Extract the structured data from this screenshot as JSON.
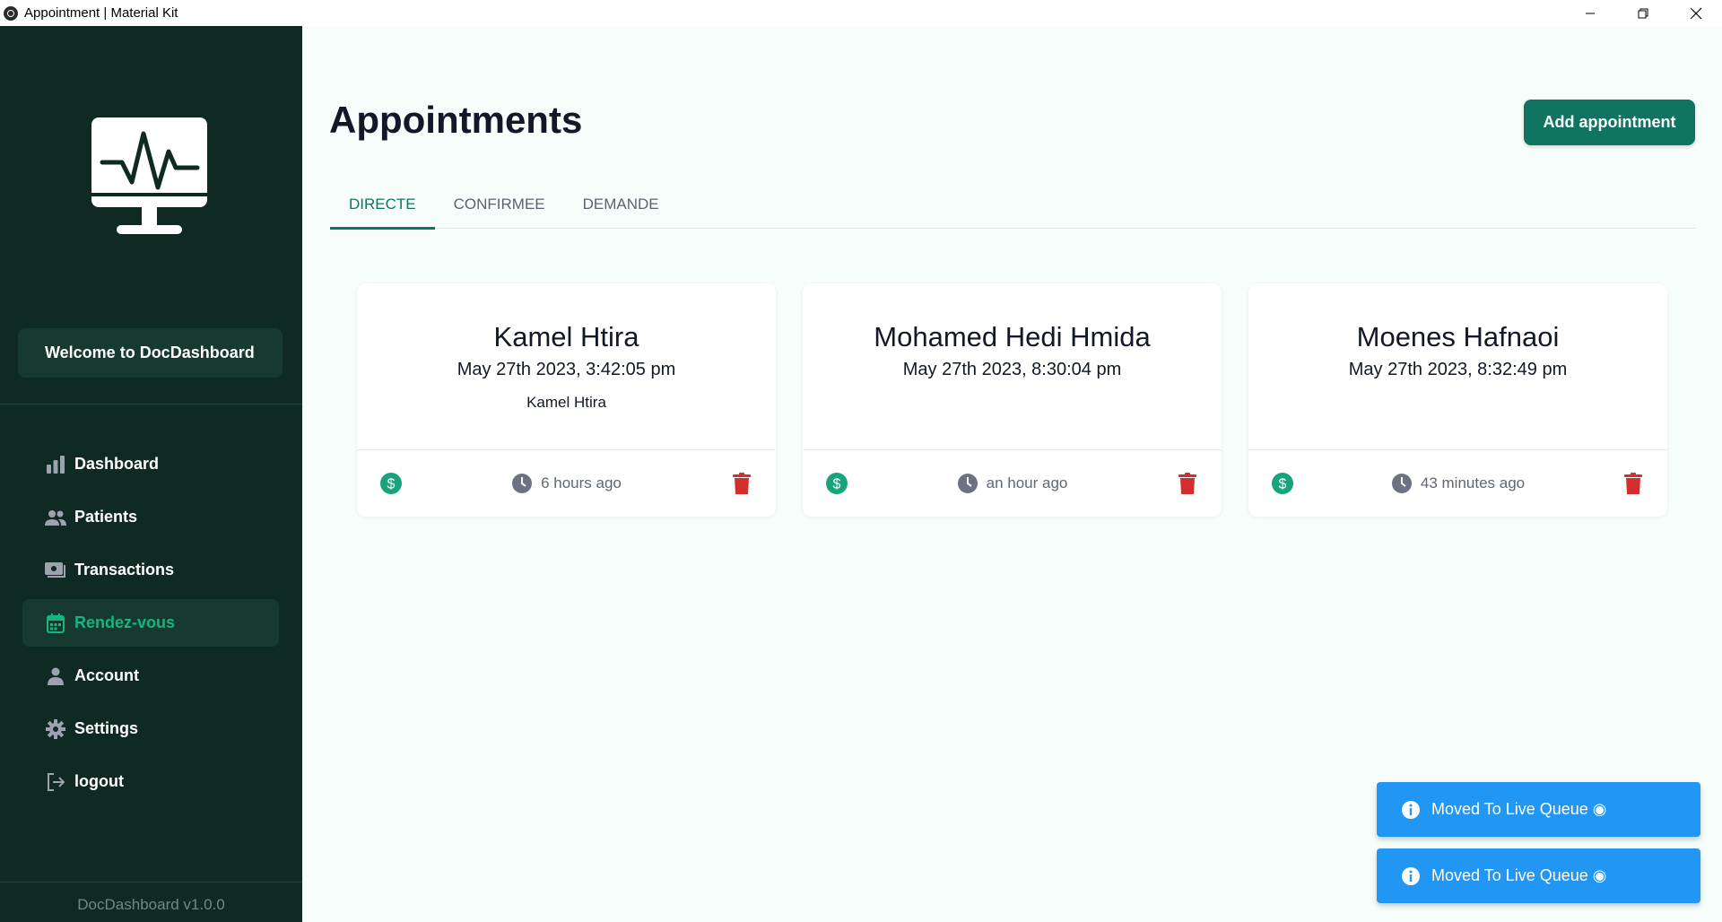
{
  "window": {
    "title": "Appointment | Material Kit"
  },
  "sidebar": {
    "welcome": "Welcome to DocDashboard",
    "items": [
      {
        "label": "Dashboard",
        "icon": "bar-chart-icon",
        "active": false
      },
      {
        "label": "Patients",
        "icon": "people-icon",
        "active": false
      },
      {
        "label": "Transactions",
        "icon": "money-icon",
        "active": false
      },
      {
        "label": "Rendez-vous",
        "icon": "calendar-icon",
        "active": true
      },
      {
        "label": "Account",
        "icon": "person-icon",
        "active": false
      },
      {
        "label": "Settings",
        "icon": "gear-icon",
        "active": false
      },
      {
        "label": "logout",
        "icon": "logout-icon",
        "active": false
      }
    ],
    "version": "DocDashboard v1.0.0"
  },
  "main": {
    "title": "Appointments",
    "add_button": "Add appointment",
    "tabs": [
      {
        "label": "DIRECTE",
        "active": true
      },
      {
        "label": "CONFIRMEE",
        "active": false
      },
      {
        "label": "DEMANDE",
        "active": false
      }
    ],
    "cards": [
      {
        "name": "Kamel Htira",
        "date": "May 27th 2023, 3:42:05 pm",
        "sub": "Kamel Htira",
        "ago": "6 hours ago"
      },
      {
        "name": "Mohamed Hedi Hmida",
        "date": "May 27th 2023, 8:30:04 pm",
        "sub": "",
        "ago": "an hour ago"
      },
      {
        "name": "Moenes Hafnaoi",
        "date": "May 27th 2023, 8:32:49 pm",
        "sub": "",
        "ago": "43 minutes ago"
      }
    ]
  },
  "toasts": [
    {
      "text": "Moved To Live Queue ◉"
    },
    {
      "text": "Moved To Live Queue ◉"
    }
  ],
  "colors": {
    "sidebar_bg": "#0e2a22",
    "accent": "#0f7560",
    "active_text": "#16b385",
    "delete": "#d32f2f",
    "toast": "#2196f3"
  }
}
